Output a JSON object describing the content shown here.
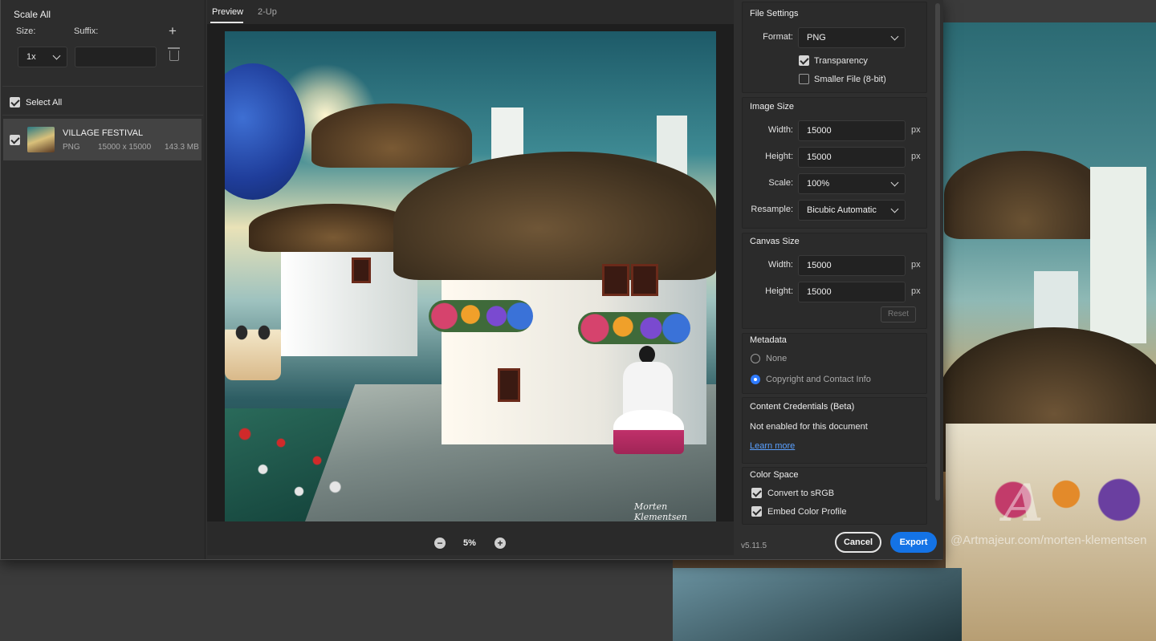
{
  "left_panel": {
    "title": "Scale All",
    "size_label": "Size:",
    "suffix_label": "Suffix:",
    "scale_value": "1x",
    "suffix_value": "",
    "select_all_label": "Select All",
    "asset": {
      "name": "VILLAGE FESTIVAL",
      "format": "PNG",
      "dimensions": "15000 x 15000",
      "file_size": "143.3 MB"
    }
  },
  "preview": {
    "tabs": [
      "Preview",
      "2-Up"
    ],
    "zoom": "5%",
    "signature": "Morten Klementsen"
  },
  "file_settings": {
    "title": "File Settings",
    "format_label": "Format:",
    "format_value": "PNG",
    "transparency_label": "Transparency",
    "transparency_checked": true,
    "smaller_file_label": "Smaller File (8-bit)",
    "smaller_file_checked": false
  },
  "image_size": {
    "title": "Image Size",
    "width_label": "Width:",
    "width_value": "15000",
    "height_label": "Height:",
    "height_value": "15000",
    "unit": "px",
    "scale_label": "Scale:",
    "scale_value": "100%",
    "resample_label": "Resample:",
    "resample_value": "Bicubic Automatic"
  },
  "canvas_size": {
    "title": "Canvas Size",
    "width_label": "Width:",
    "width_value": "15000",
    "height_label": "Height:",
    "height_value": "15000",
    "unit": "px",
    "reset_label": "Reset"
  },
  "metadata": {
    "title": "Metadata",
    "options": [
      "None",
      "Copyright and Contact Info"
    ],
    "selected": "Copyright and Contact Info"
  },
  "content_credentials": {
    "title": "Content Credentials (Beta)",
    "status": "Not enabled for this document",
    "link": "Learn more"
  },
  "color_space": {
    "title": "Color Space",
    "convert_label": "Convert to sRGB",
    "convert_checked": true,
    "embed_label": "Embed Color Profile",
    "embed_checked": true
  },
  "footer": {
    "version": "v5.11.5",
    "cancel_label": "Cancel",
    "export_label": "Export"
  },
  "background": {
    "watermark": "@Artmajeur.com/morten-klementsen",
    "logo": "A"
  },
  "colors": {
    "accent": "#1473e6",
    "link": "#5aa0ff",
    "panel_bg": "#2f2f2f"
  }
}
